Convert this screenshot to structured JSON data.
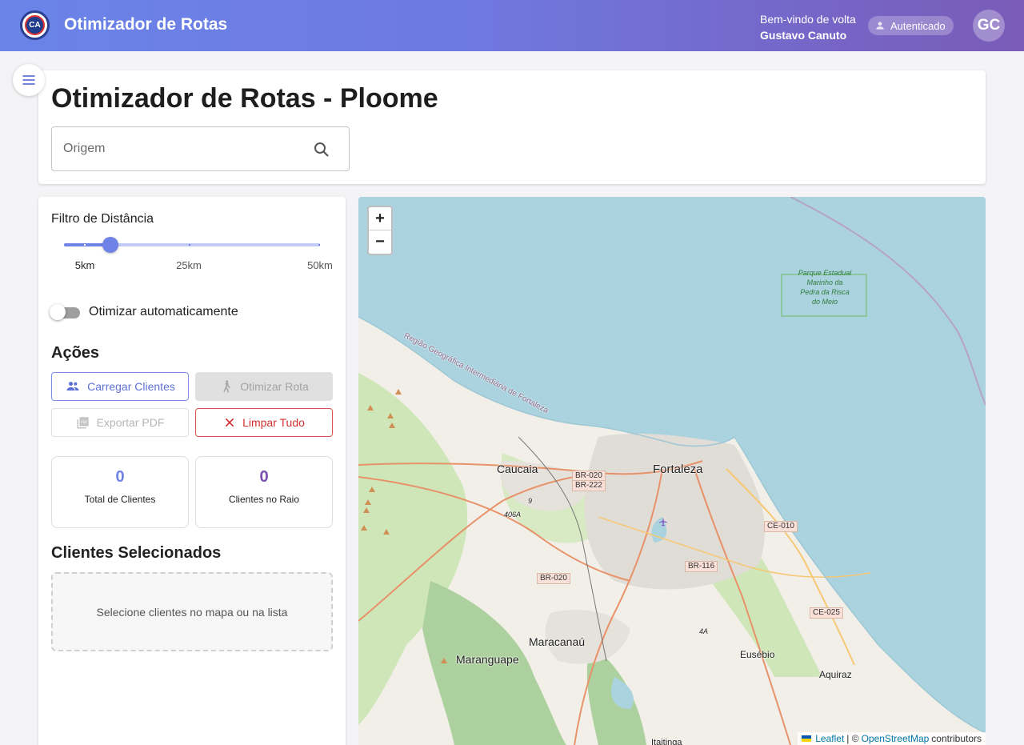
{
  "header": {
    "app_title": "Otimizador de Rotas",
    "welcome_text": "Bem-vindo de volta",
    "user_name": "Gustavo Canuto",
    "auth_status": "Autenticado",
    "avatar_initials": "GC"
  },
  "page": {
    "title": "Otimizador de Rotas - Ploome",
    "origin_placeholder": "Origem"
  },
  "filter": {
    "label": "Filtro de Distância",
    "slider_value_km": 5,
    "slider_max_km": 50,
    "marks": [
      "5km",
      "25km",
      "50km"
    ]
  },
  "auto_optimize": {
    "label": "Otimizar automaticamente",
    "enabled": false
  },
  "actions": {
    "heading": "Ações",
    "load_clients": "Carregar Clientes",
    "optimize_route": "Otimizar Rota",
    "export_pdf": "Exportar PDF",
    "clear_all": "Limpar Tudo"
  },
  "stats": {
    "total_clients_value": "0",
    "total_clients_label": "Total de Clientes",
    "clients_in_radius_value": "0",
    "clients_in_radius_label": "Clientes no Raio"
  },
  "selected": {
    "heading": "Clientes Selecionados",
    "empty_text": "Selecione clientes no mapa ou na lista"
  },
  "map": {
    "zoom_in": "+",
    "zoom_out": "−",
    "attribution_leaflet": "Leaflet",
    "attribution_sep": "| ©",
    "attribution_osm": "OpenStreetMap",
    "attribution_contrib": "contributors",
    "places": {
      "fortaleza": "Fortaleza",
      "caucaia": "Caucaia",
      "maracanau": "Maracanaú",
      "maranguape": "Maranguape",
      "eusebio": "Eusébio",
      "aquiraz": "Aquiraz",
      "itaitinga": "Itaitinga",
      "region": "Região Geográfica Intermediária de Fortaleza",
      "park": "Parque Estadual Marinho da Pedra da Risca do Meio"
    },
    "roads": [
      "BR-020",
      "BR-222",
      "CE-010",
      "BR-116",
      "BR-020",
      "CE-025",
      "4A",
      "9",
      "406A"
    ]
  },
  "colors": {
    "header_start": "#6a84e8",
    "header_end": "#7a5bb8",
    "primary": "#6f83e6",
    "danger": "#d32f2f",
    "stat_total": "#6f83e6",
    "stat_radius": "#7b4fb0"
  }
}
